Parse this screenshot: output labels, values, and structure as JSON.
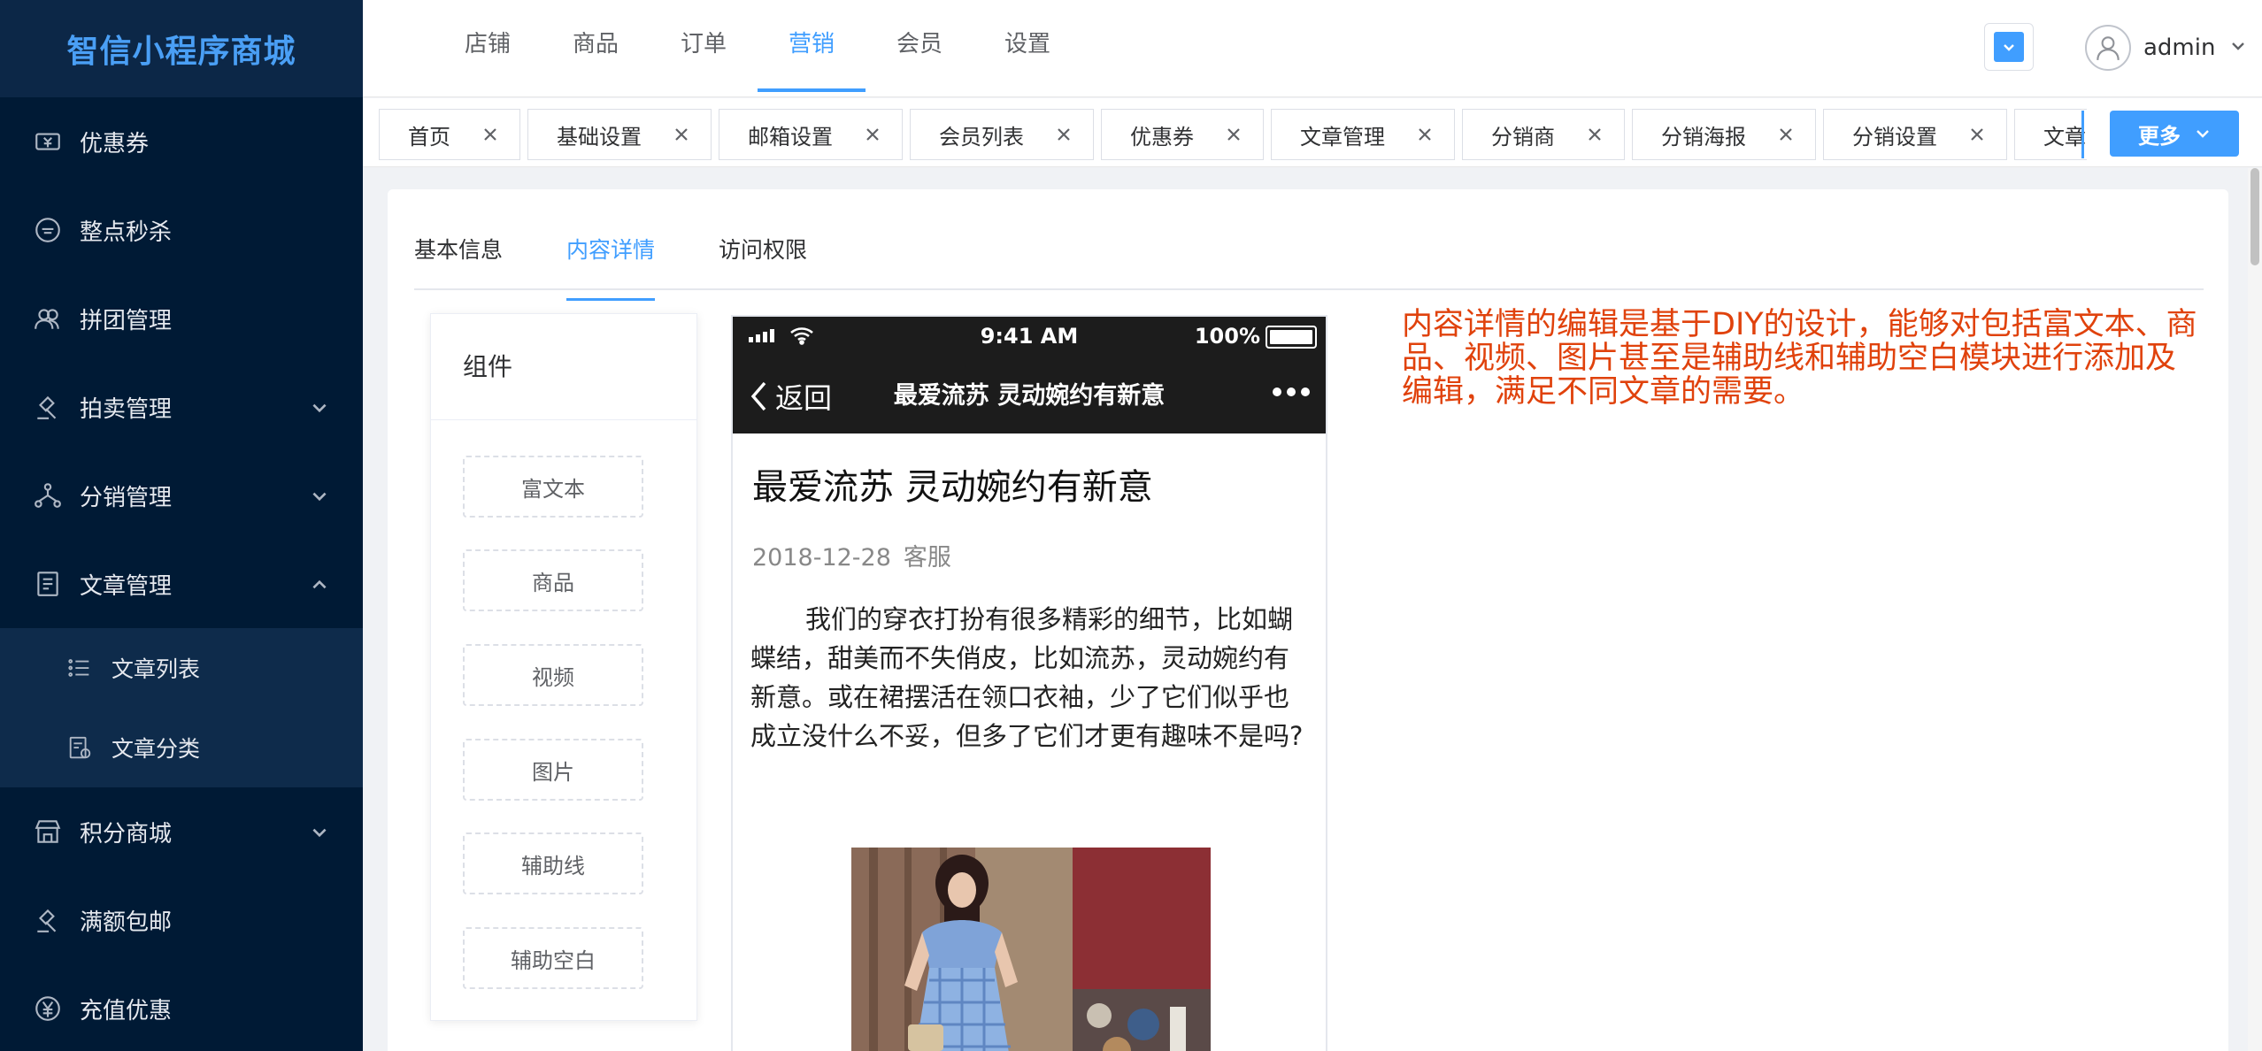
{
  "brand": "智信小程序商城",
  "sidebar": {
    "items": [
      {
        "label": "优惠券",
        "icon": "coupon-icon",
        "expandable": false
      },
      {
        "label": "整点秒杀",
        "icon": "flash-sale-icon",
        "expandable": false
      },
      {
        "label": "拼团管理",
        "icon": "group-buy-icon",
        "expandable": false
      },
      {
        "label": "拍卖管理",
        "icon": "auction-icon",
        "expandable": true
      },
      {
        "label": "分销管理",
        "icon": "distribution-icon",
        "expandable": true
      },
      {
        "label": "文章管理",
        "icon": "article-icon",
        "expandable": true,
        "expanded": true,
        "children": [
          {
            "label": "文章列表",
            "icon": "list-icon"
          },
          {
            "label": "文章分类",
            "icon": "category-icon"
          }
        ]
      },
      {
        "label": "积分商城",
        "icon": "points-mall-icon",
        "expandable": true
      },
      {
        "label": "满额包邮",
        "icon": "free-shipping-icon",
        "expandable": false
      },
      {
        "label": "充值优惠",
        "icon": "recharge-icon",
        "expandable": false
      }
    ]
  },
  "topnav": {
    "items": [
      "店铺",
      "商品",
      "订单",
      "营销",
      "会员",
      "设置"
    ],
    "active": "营销"
  },
  "user": {
    "name": "admin"
  },
  "tagbar": {
    "tags": [
      "首页",
      "基础设置",
      "邮箱设置",
      "会员列表",
      "优惠券",
      "文章管理",
      "分销商",
      "分销海报",
      "分销设置",
      "文章分类"
    ],
    "more_label": "更多"
  },
  "content_tabs": {
    "items": [
      "基本信息",
      "内容详情",
      "访问权限"
    ],
    "active": "内容详情"
  },
  "components": {
    "title": "组件",
    "items": [
      "富文本",
      "商品",
      "视频",
      "图片",
      "辅助线",
      "辅助空白"
    ]
  },
  "phone": {
    "status": {
      "time": "9:41 AM",
      "battery": "100%"
    },
    "nav": {
      "back": "返回",
      "title": "最爱流苏 灵动婉约有新意"
    },
    "article": {
      "title": "最爱流苏 灵动婉约有新意",
      "date": "2018-12-28",
      "author": "客服",
      "body": "我们的穿衣打扮有很多精彩的细节，比如蝴蝶结，甜美而不失俏皮，比如流苏，灵动婉约有新意。或在裙摆活在领口衣袖，少了它们似乎也成立没什么不妥，但多了它们才更有趣味不是吗?"
    }
  },
  "note": "内容详情的编辑是基于DIY的设计，能够对包括富文本、商品、视频、图片甚至是辅助线和辅助空白模块进行添加及编辑，满足不同文章的需要。",
  "colors": {
    "accent": "#409eff",
    "sidebar_bg": "#001a35",
    "note": "#e0420c"
  }
}
